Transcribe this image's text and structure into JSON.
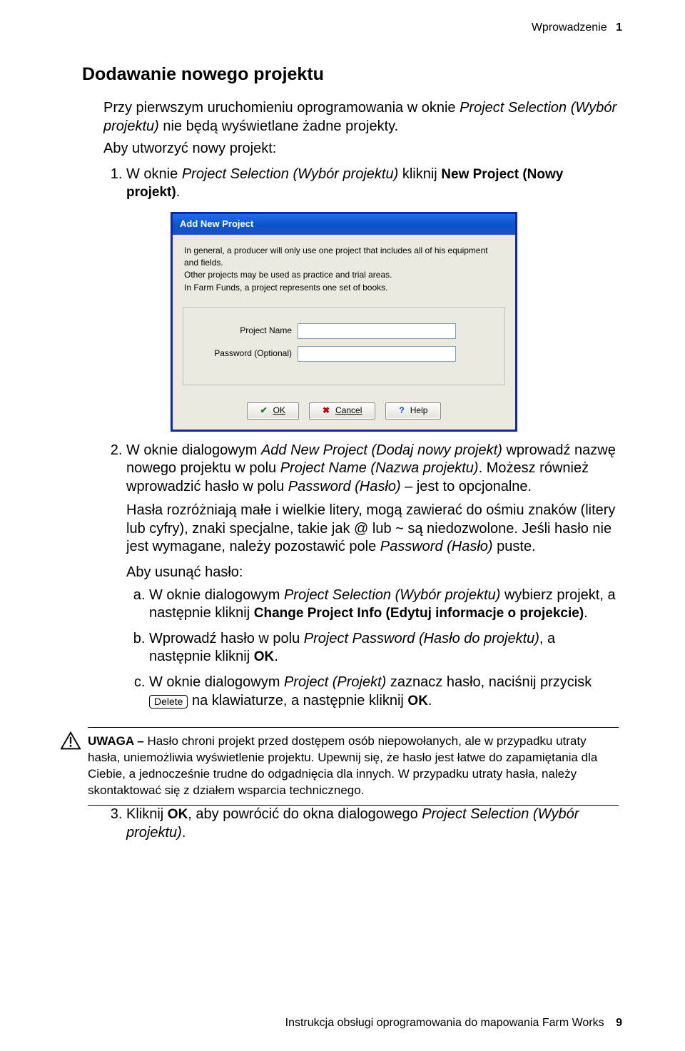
{
  "header": {
    "title": "Wprowadzenie",
    "chapter": "1"
  },
  "section_title": "Dodawanie nowego projektu",
  "intro_a": "Przy pierwszym uruchomieniu oprogramowania w oknie ",
  "intro_b": "Project Selection (Wybór projektu)",
  "intro_c": " nie będą wyświetlane żadne projekty.",
  "lead2": "Aby utworzyć nowy projekt:",
  "step1_a": "W oknie ",
  "step1_b": "Project Selection (Wybór projektu)",
  "step1_c": " kliknij ",
  "step1_d": "New Project (Nowy projekt)",
  "step1_e": ".",
  "dialog": {
    "title": "Add New Project",
    "info1": "In general, a producer will only use one project that includes all of his equipment and fields.",
    "info2": "Other projects may be used as practice and trial areas.",
    "info3": "In Farm Funds, a project represents one set of books.",
    "label_project_name": "Project Name",
    "label_password": "Password  (Optional)",
    "btn_ok": "OK",
    "btn_cancel": "Cancel",
    "btn_help": "Help"
  },
  "step2_a": "W oknie dialogowym ",
  "step2_b": "Add New Project (Dodaj nowy projekt)",
  "step2_c": " wprowadź nazwę nowego projektu w polu ",
  "step2_d": "Project Name (Nazwa projektu)",
  "step2_e": ". Możesz również wprowadzić hasło w polu ",
  "step2_f": "Password (Hasło)",
  "step2_g": " – jest to opcjonalne.",
  "para_pw_a": "Hasła rozróżniają małe i wielkie litery, mogą zawierać do ośmiu znaków (litery lub cyfry), znaki specjalne, takie jak @ lub ~ są niedozwolone. Jeśli hasło nie jest wymagane, należy pozostawić pole ",
  "para_pw_b": "Password (Hasło)",
  "para_pw_c": " puste.",
  "remove_pw": "Aby usunąć hasło:",
  "a_a": "W oknie dialogowym ",
  "a_b": "Project Selection (Wybór projektu)",
  "a_c": " wybierz projekt, a następnie kliknij ",
  "a_d": "Change Project Info (Edytuj informacje o projekcie)",
  "a_e": ".",
  "b_a": "Wprowadź hasło w polu ",
  "b_b": "Project Password (Hasło do projektu)",
  "b_c": ", a następnie kliknij ",
  "b_d": "OK",
  "b_e": ".",
  "c_a": "W oknie dialogowym ",
  "c_b": "Project (Projekt)",
  "c_c": " zaznacz hasło, naciśnij przycisk ",
  "c_key": "Delete",
  "c_d": " na klawiaturze, a następnie kliknij ",
  "c_e": "OK",
  "c_f": ".",
  "caution_lead": "UWAGA – ",
  "caution_body": "Hasło chroni projekt przed dostępem osób niepowołanych, ale w przypadku utraty hasła, uniemożliwia wyświetlenie projektu. Upewnij się, że hasło jest łatwe do zapamiętania dla Ciebie, a jednocześnie trudne do odgadnięcia dla innych. W przypadku utraty hasła, należy skontaktować się z działem wsparcia technicznego.",
  "step3_a": "Kliknij ",
  "step3_b": "OK",
  "step3_c": ", aby powrócić do okna dialogowego ",
  "step3_d": "Project Selection (Wybór projektu)",
  "step3_e": ".",
  "footer": {
    "title": "Instrukcja obsługi oprogramowania do mapowania Farm Works",
    "page": "9"
  }
}
